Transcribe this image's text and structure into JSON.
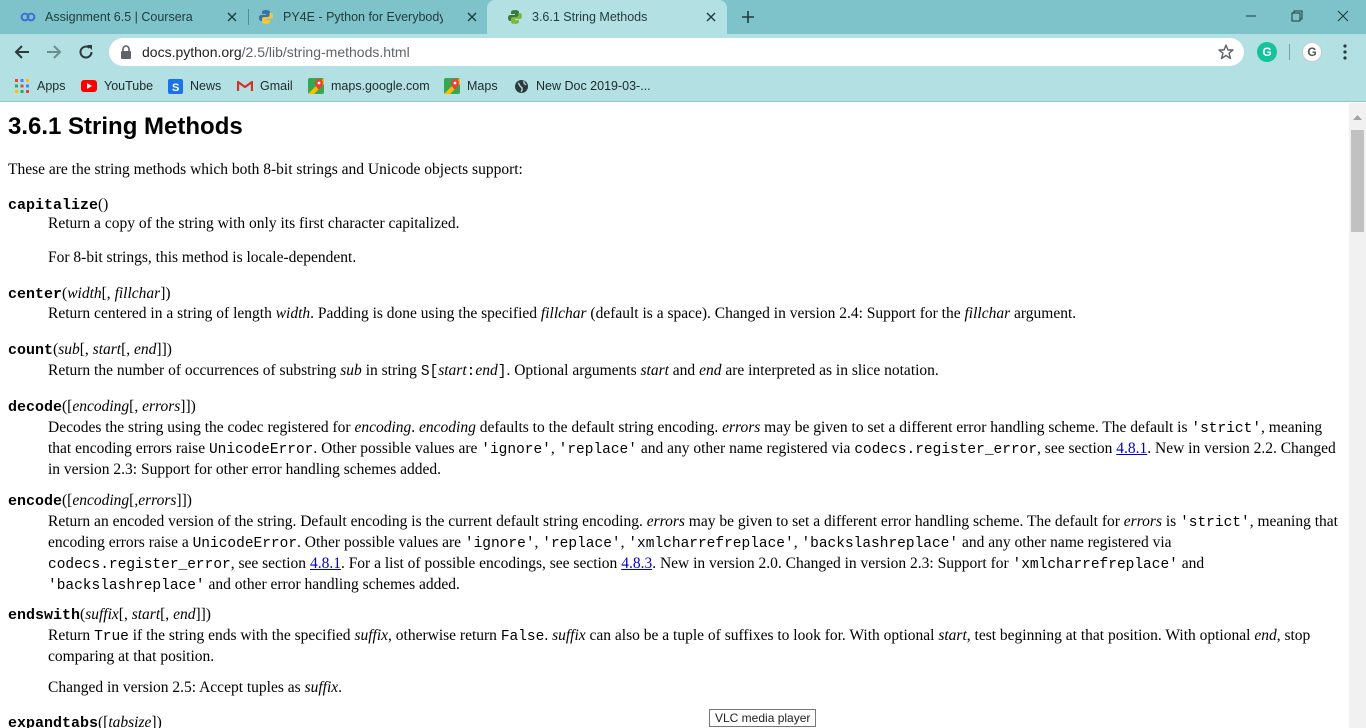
{
  "tabs": [
    {
      "title": "Assignment 6.5 | Coursera",
      "icon": "coursera-icon"
    },
    {
      "title": "PY4E - Python for Everybody",
      "icon": "python-icon"
    },
    {
      "title": "3.6.1 String Methods",
      "icon": "python-docs-icon",
      "active": true
    }
  ],
  "omnibox": {
    "host": "docs.python.org",
    "path": "/2.5/lib/string-methods.html"
  },
  "extensions": [
    {
      "label": "G",
      "color": "#15c39a"
    },
    {
      "label": "G",
      "color": "#ffffff"
    }
  ],
  "bookmarks": [
    {
      "label": "Apps"
    },
    {
      "label": "YouTube"
    },
    {
      "label": "News"
    },
    {
      "label": "Gmail"
    },
    {
      "label": "maps.google.com"
    },
    {
      "label": "Maps"
    },
    {
      "label": "New Doc 2019-03-..."
    }
  ],
  "doc": {
    "title": "3.6.1 String Methods",
    "intro": "These are the string methods which both 8-bit strings and Unicode objects support:",
    "capitalize": {
      "name": "capitalize",
      "args": "()",
      "desc": "Return a copy of the string with only its first character capitalized.",
      "note": "For 8-bit strings, this method is locale-dependent."
    },
    "center": {
      "name": "center",
      "a1": "(",
      "a2": "width",
      "a3": "[, ",
      "a4": "fillchar",
      "a5": "])",
      "d1": "Return centered in a string of length ",
      "d2": "width",
      "d3": ". Padding is done using the specified ",
      "d4": "fillchar",
      "d5": " (default is a space). Changed in version 2.4: Support for the ",
      "d6": "fillchar",
      "d7": " argument."
    },
    "count": {
      "name": "count",
      "a1": "(",
      "a2": "sub",
      "a3": "[, ",
      "a4": "start",
      "a5": "[, ",
      "a6": "end",
      "a7": "]])",
      "d1": "Return the number of occurrences of substring ",
      "d2": "sub",
      "d3": " in string ",
      "d4": "S[",
      "d5": "start",
      "d6": ":",
      "d7": "end",
      "d8": "]",
      "d9": ". Optional arguments ",
      "d10": "start",
      "d11": " and ",
      "d12": "end",
      "d13": " are interpreted as in slice notation."
    },
    "decode": {
      "name": "decode",
      "a1": "([",
      "a2": "encoding",
      "a3": "[, ",
      "a4": "errors",
      "a5": "]])",
      "d1": "Decodes the string using the codec registered for ",
      "d2": "encoding",
      "d3": ". ",
      "d4": "encoding",
      "d5": " defaults to the default string encoding. ",
      "d6": "errors",
      "d7": " may be given to set a different error handling scheme. The default is ",
      "d8": "'strict'",
      "d9": ", meaning that encoding errors raise ",
      "d10": "UnicodeError",
      "d11": ". Other possible values are ",
      "d12": "'ignore'",
      "d13": ", ",
      "d14": "'replace'",
      "d15": " and any other name registered via ",
      "d16": "codecs.register_error",
      "d17": ", see section ",
      "d18": "4.8.1",
      "d19": ". New in version 2.2. Changed in version 2.3: Support for other error handling schemes added."
    },
    "encode": {
      "name": "encode",
      "a1": "([",
      "a2": "encoding",
      "a3": "[,",
      "a4": "errors",
      "a5": "]])",
      "d1": "Return an encoded version of the string. Default encoding is the current default string encoding. ",
      "d2": "errors",
      "d3": " may be given to set a different error handling scheme. The default for ",
      "d4": "errors",
      "d5": " is ",
      "d6": "'strict'",
      "d7": ", meaning that encoding errors raise a ",
      "d8": "UnicodeError",
      "d9": ". Other possible values are ",
      "d10": "'ignore'",
      "d11": ", ",
      "d12": "'replace'",
      "d13": ", ",
      "d14": "'xmlcharrefreplace'",
      "d15": ", ",
      "d16": "'backslashreplace'",
      "d17": " and any other name registered via ",
      "d18": "codecs.register_error",
      "d19": ", see section ",
      "d20": "4.8.1",
      "d21": ". For a list of possible encodings, see section ",
      "d22": "4.8.3",
      "d23": ". New in version 2.0. Changed in version 2.3: Support for ",
      "d24": "'xmlcharrefreplace'",
      "d25": " and ",
      "d26": "'backslashreplace'",
      "d27": " and other error handling schemes added."
    },
    "endswith": {
      "name": "endswith",
      "a1": "(",
      "a2": "suffix",
      "a3": "[, ",
      "a4": "start",
      "a5": "[, ",
      "a6": "end",
      "a7": "]])",
      "d1": "Return ",
      "d2": "True",
      "d3": " if the string ends with the specified ",
      "d4": "suffix",
      "d5": ", otherwise return ",
      "d6": "False",
      "d7": ". ",
      "d8": "suffix",
      "d9": " can also be a tuple of suffixes to look for. With optional ",
      "d10": "start",
      "d11": ", test beginning at that position. With optional ",
      "d12": "end",
      "d13": ", stop comparing at that position.",
      "n1": "Changed in version 2.5: Accept tuples as ",
      "n2": "suffix",
      "n3": "."
    },
    "expandtabs": {
      "name": "expandtabs",
      "a1": "([",
      "a2": "tabsize",
      "a3": "])"
    }
  },
  "tooltip": "VLC media player"
}
